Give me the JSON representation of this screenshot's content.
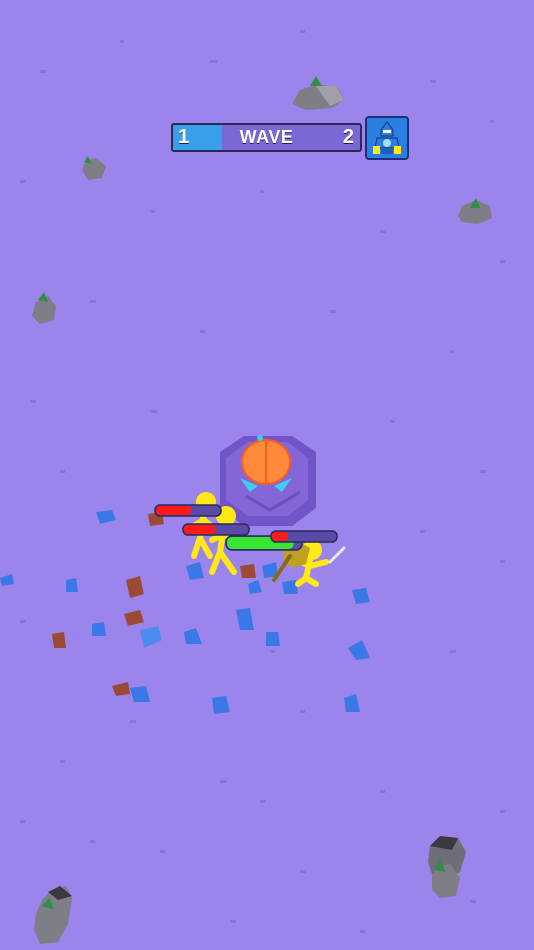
{
  "hud": {
    "current_wave": "1",
    "wave_label": "WAVE",
    "next_wave": "2",
    "progress": 0.26,
    "boss_icon": "armored-knight-icon"
  },
  "colors": {
    "ground": "#9b84ec",
    "progress_fill": "#38a0ea",
    "progress_track": "#7b68d6",
    "enemy_health": "#ff1a1a",
    "player_health": "#38e632",
    "player": "#ffe816"
  },
  "scene": {
    "player_health": 0.9,
    "enemy_health": [
      0.55,
      0.5,
      0.25
    ]
  }
}
